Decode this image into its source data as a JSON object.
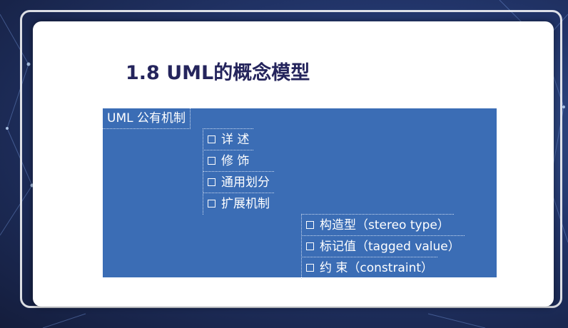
{
  "title": "1.8 UML的概念模型",
  "root_label": "UML 公有机制",
  "level1": [
    "详 述",
    "修 饰",
    "通用划分",
    "扩展机制"
  ],
  "level2": [
    "构造型（stereo type）",
    "标记值（tagged value）",
    "约 束（constraint）"
  ],
  "colors": {
    "panel": "#3b6db5",
    "title": "#24245c",
    "background": "#1c2a55"
  }
}
